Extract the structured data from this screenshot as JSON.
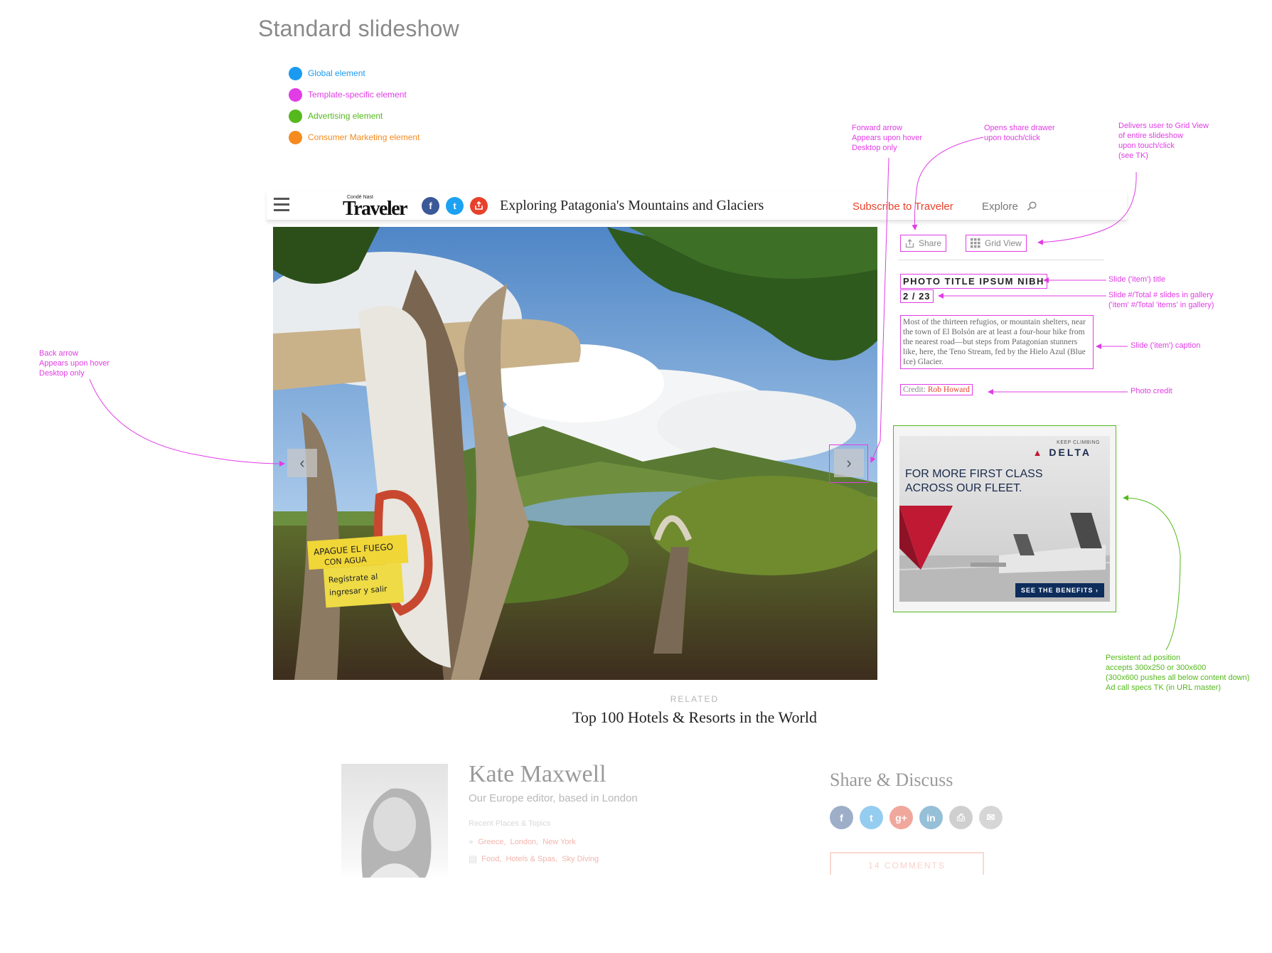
{
  "page": {
    "title": "Standard slideshow"
  },
  "legend": [
    {
      "label": "Global element",
      "color": "#1a9af1"
    },
    {
      "label": "Template-specific element",
      "color": "#e23ce6"
    },
    {
      "label": "Advertising element",
      "color": "#55b91d"
    },
    {
      "label": "Consumer Marketing element",
      "color": "#f58a1f"
    }
  ],
  "annotations": {
    "forward_arrow": "Forward arrow\nAppears upon hover\nDesktop only",
    "share_drawer": "Opens share drawer\nupon touch/click",
    "grid_view": "Delivers user to Grid View\nof entire slideshow\nupon touch/click\n(see TK)",
    "back_arrow": "Back arrow\nAppears upon hover\nDesktop only",
    "slide_title": "Slide ('item') title",
    "slide_count": "Slide #/Total # slides in gallery\n('item' #/Total 'items' in gallery)",
    "slide_caption": "Slide ('item') caption",
    "photo_credit": "Photo credit",
    "ad_position": "Persistent ad position\naccepts 300x250 or 300x600\n(300x600 pushes all below content down)\nAd call specs TK (in URL master)"
  },
  "nav": {
    "logo_small": "Condé Nast",
    "logo_big": "Traveler",
    "headline": "Exploring Patagonia's Mountains and Glaciers",
    "subscribe": "Subscribe to Traveler",
    "explore": "Explore",
    "icons": {
      "menu": "hamburger-menu-icon",
      "facebook": "facebook-icon",
      "twitter": "twitter-icon",
      "share": "share-icon",
      "search": "search-icon"
    }
  },
  "slideshow": {
    "share_label": "Share",
    "grid_label": "Grid View",
    "slide_title": "PHOTO TITLE IPSUM NIBH",
    "slide_count": "2 / 23",
    "caption": "Most of the thirteen refugios, or mountain shelters, near the town of El Bolsón are at least a four-hour hike from the nearest road—but steps from Patagonian stunners like, here, the Teno Stream, fed by the Hielo Azul (Blue Ice) Glacier.",
    "credit_label": "Credit:",
    "credit_name": "Rob Howard",
    "sign_text": [
      "APAGUE EL FUEGO",
      "CON AGUA",
      "Regístrate al",
      "ingresar y salir"
    ]
  },
  "ad": {
    "tagline": "KEEP CLIMBING",
    "brand": "DELTA",
    "headline_1": "FOR MORE FIRST CLASS",
    "headline_2": "ACROSS OUR FLEET.",
    "cta": "SEE THE BENEFITS ›"
  },
  "related": {
    "label": "RELATED",
    "title": "Top 100 Hotels & Resorts in the World"
  },
  "author": {
    "name": "Kate Maxwell",
    "role": "Our Europe editor, based in London",
    "recent_label": "Recent Places & Topics",
    "places": [
      "Greece,",
      "London,",
      "New York"
    ],
    "topics": [
      "Food,",
      "Hotels & Spas,",
      "Sky Diving"
    ]
  },
  "share_discuss": {
    "title": "Share & Discuss",
    "icons": [
      {
        "name": "facebook-share-icon",
        "glyph": "f",
        "color": "#3b5998"
      },
      {
        "name": "twitter-share-icon",
        "glyph": "t",
        "color": "#1da1f2"
      },
      {
        "name": "google-plus-share-icon",
        "glyph": "g+",
        "color": "#e8412b"
      },
      {
        "name": "linkedin-share-icon",
        "glyph": "in",
        "color": "#0e76a8"
      },
      {
        "name": "print-icon",
        "glyph": "⎙",
        "color": "#888888"
      },
      {
        "name": "email-icon",
        "glyph": "✉",
        "color": "#999999"
      }
    ],
    "comments": "14 COMMENTS"
  }
}
